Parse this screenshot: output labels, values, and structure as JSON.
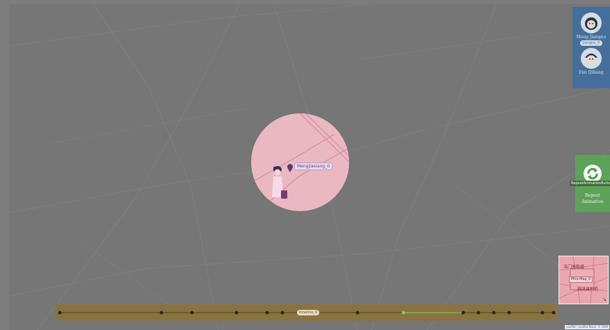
{
  "colors": {
    "map_bg": "#767676",
    "spotlight": "#e9b8c3",
    "people_panel": "#3f6f9f",
    "repeat_panel": "#5ea25a",
    "timeline": "#8a7342",
    "timeline_active": "#7fd35a"
  },
  "map": {
    "marker_label": "MengJiaxiang_0"
  },
  "people": [
    {
      "name": "Meng Jiangnu",
      "badge": "Jiangnu_0",
      "icon": "avatar-girl-icon"
    },
    {
      "name": "Fan Qiliang",
      "badge": "",
      "icon": "avatar-boy-icon"
    }
  ],
  "repeat": {
    "button_name": "RepeatAnimationButton",
    "label_line1": "Repeat",
    "label_line2": "Animation",
    "icon": "refresh-icon"
  },
  "minimap": {
    "text_top": "玉门关街道",
    "tag": "Mini-Map_0",
    "text_bottom": "临洮县附近",
    "icon": "expand-arrow-icon"
  },
  "timeline": {
    "label": "timeline_0",
    "stop_count": 17,
    "active_index": 10
  },
  "attribution": "Leaflet | Leaflet Mask, © OSM"
}
